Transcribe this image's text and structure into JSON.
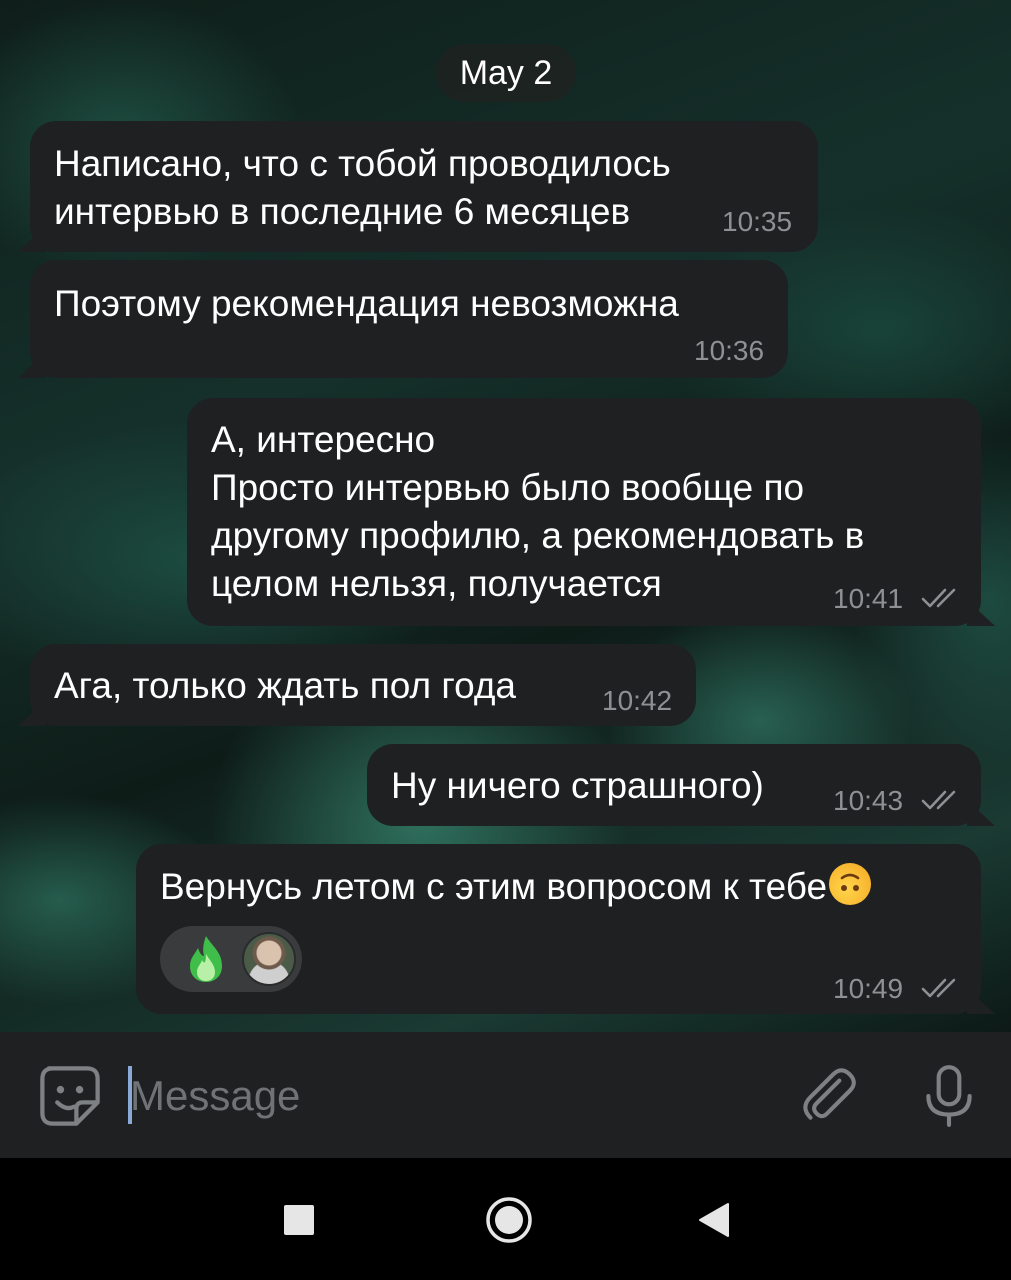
{
  "chat": {
    "date_label": "May 2",
    "messages": [
      {
        "side": "in",
        "text_lines": [
          "Написано, что с тобой проводилось",
          "интервью в последние 6 месяцев"
        ],
        "time": "10:35"
      },
      {
        "side": "in",
        "text_lines": [
          "Поэтому рекомендация невозможна"
        ],
        "time": "10:36"
      },
      {
        "side": "out",
        "text_lines": [
          "А, интересно",
          "Просто интервью было вообще по",
          "другому профилю, а рекомендовать в",
          "целом нельзя, получается"
        ],
        "time": "10:41",
        "status": "double-check-icon"
      },
      {
        "side": "in",
        "text_lines": [
          "Ага, только ждать пол года"
        ],
        "time": "10:42"
      },
      {
        "side": "out",
        "text_lines": [
          "Ну ничего страшного)"
        ],
        "time": "10:43",
        "status": "double-check-icon"
      },
      {
        "side": "out",
        "text_lines": [
          "Вернусь летом с этим вопросом к тебе"
        ],
        "emoji": "upside-down-face-emoji",
        "reaction": "fire-emoji",
        "time": "10:49",
        "status": "double-check-icon"
      }
    ]
  },
  "composer": {
    "placeholder": "Message",
    "icons": [
      "sticker-icon",
      "attach-icon",
      "microphone-icon"
    ]
  },
  "system_nav": {
    "icons": [
      "recents-square-icon",
      "home-circle-icon",
      "back-triangle-icon"
    ]
  },
  "colors": {
    "bubble": "#1f2021",
    "time_text": "#8d9194",
    "input_bar": "#1f2021",
    "nav_bar": "#000000"
  }
}
